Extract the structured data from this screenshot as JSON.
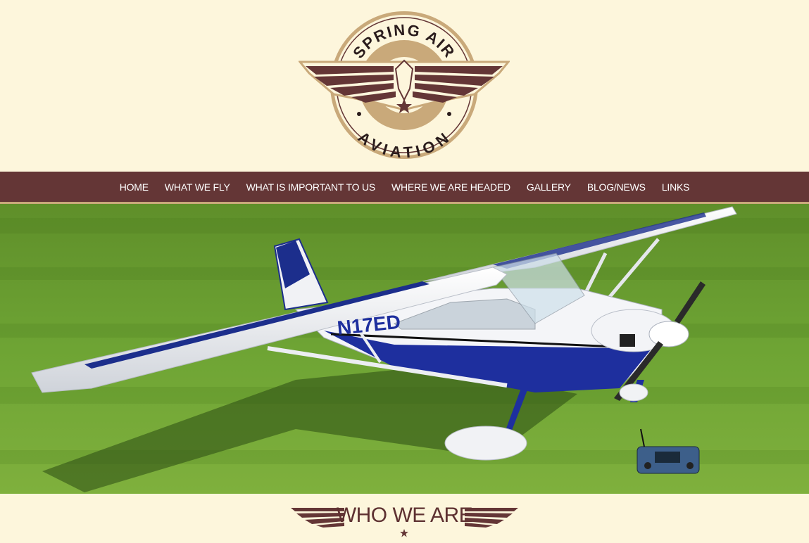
{
  "logo": {
    "top_text": "SPRING AIR",
    "bottom_text": "AVIATION"
  },
  "nav": {
    "items": [
      {
        "label": "HOME"
      },
      {
        "label": "WHAT WE FLY"
      },
      {
        "label": "WHAT IS IMPORTANT TO US"
      },
      {
        "label": "WHERE WE ARE HEADED"
      },
      {
        "label": "GALLERY"
      },
      {
        "label": "BLOG/NEWS"
      },
      {
        "label": "LINKS"
      }
    ]
  },
  "hero": {
    "image": "rc-airplane-on-grass",
    "plane_tail": "N17ED"
  },
  "section": {
    "title": "WHO WE ARE"
  },
  "colors": {
    "background": "#fdf6dc",
    "nav": "#643636",
    "accent": "#c9a97a",
    "brown": "#5e3131"
  }
}
